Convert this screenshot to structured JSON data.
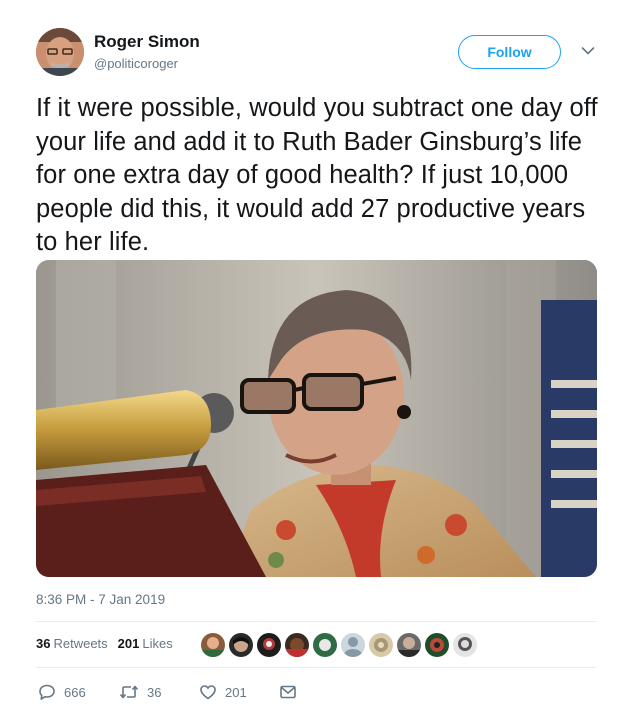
{
  "user": {
    "name": "Roger Simon",
    "handle": "@politicoroger"
  },
  "follow_label": "Follow",
  "tweet": {
    "text": "If it were possible, would you subtract one day off your life and add it to Ruth Bader Ginsburg’s life for one extra day of good health? If just 10,000 people did this, it would add 27 productive years to her life.",
    "timestamp": "8:36 PM - 7 Jan 2019"
  },
  "stats": {
    "retweets_count": "36",
    "retweets_label": "Retweets",
    "likes_count": "201",
    "likes_label": "Likes"
  },
  "actions": {
    "replies": "666",
    "retweets": "36",
    "likes": "201"
  },
  "colors": {
    "accent": "#1da1f2",
    "secondary_text": "#657786",
    "divider": "#e6ecf0"
  },
  "icons": [
    "chevron-down-icon",
    "reply-icon",
    "retweet-icon",
    "heart-icon",
    "envelope-icon"
  ]
}
